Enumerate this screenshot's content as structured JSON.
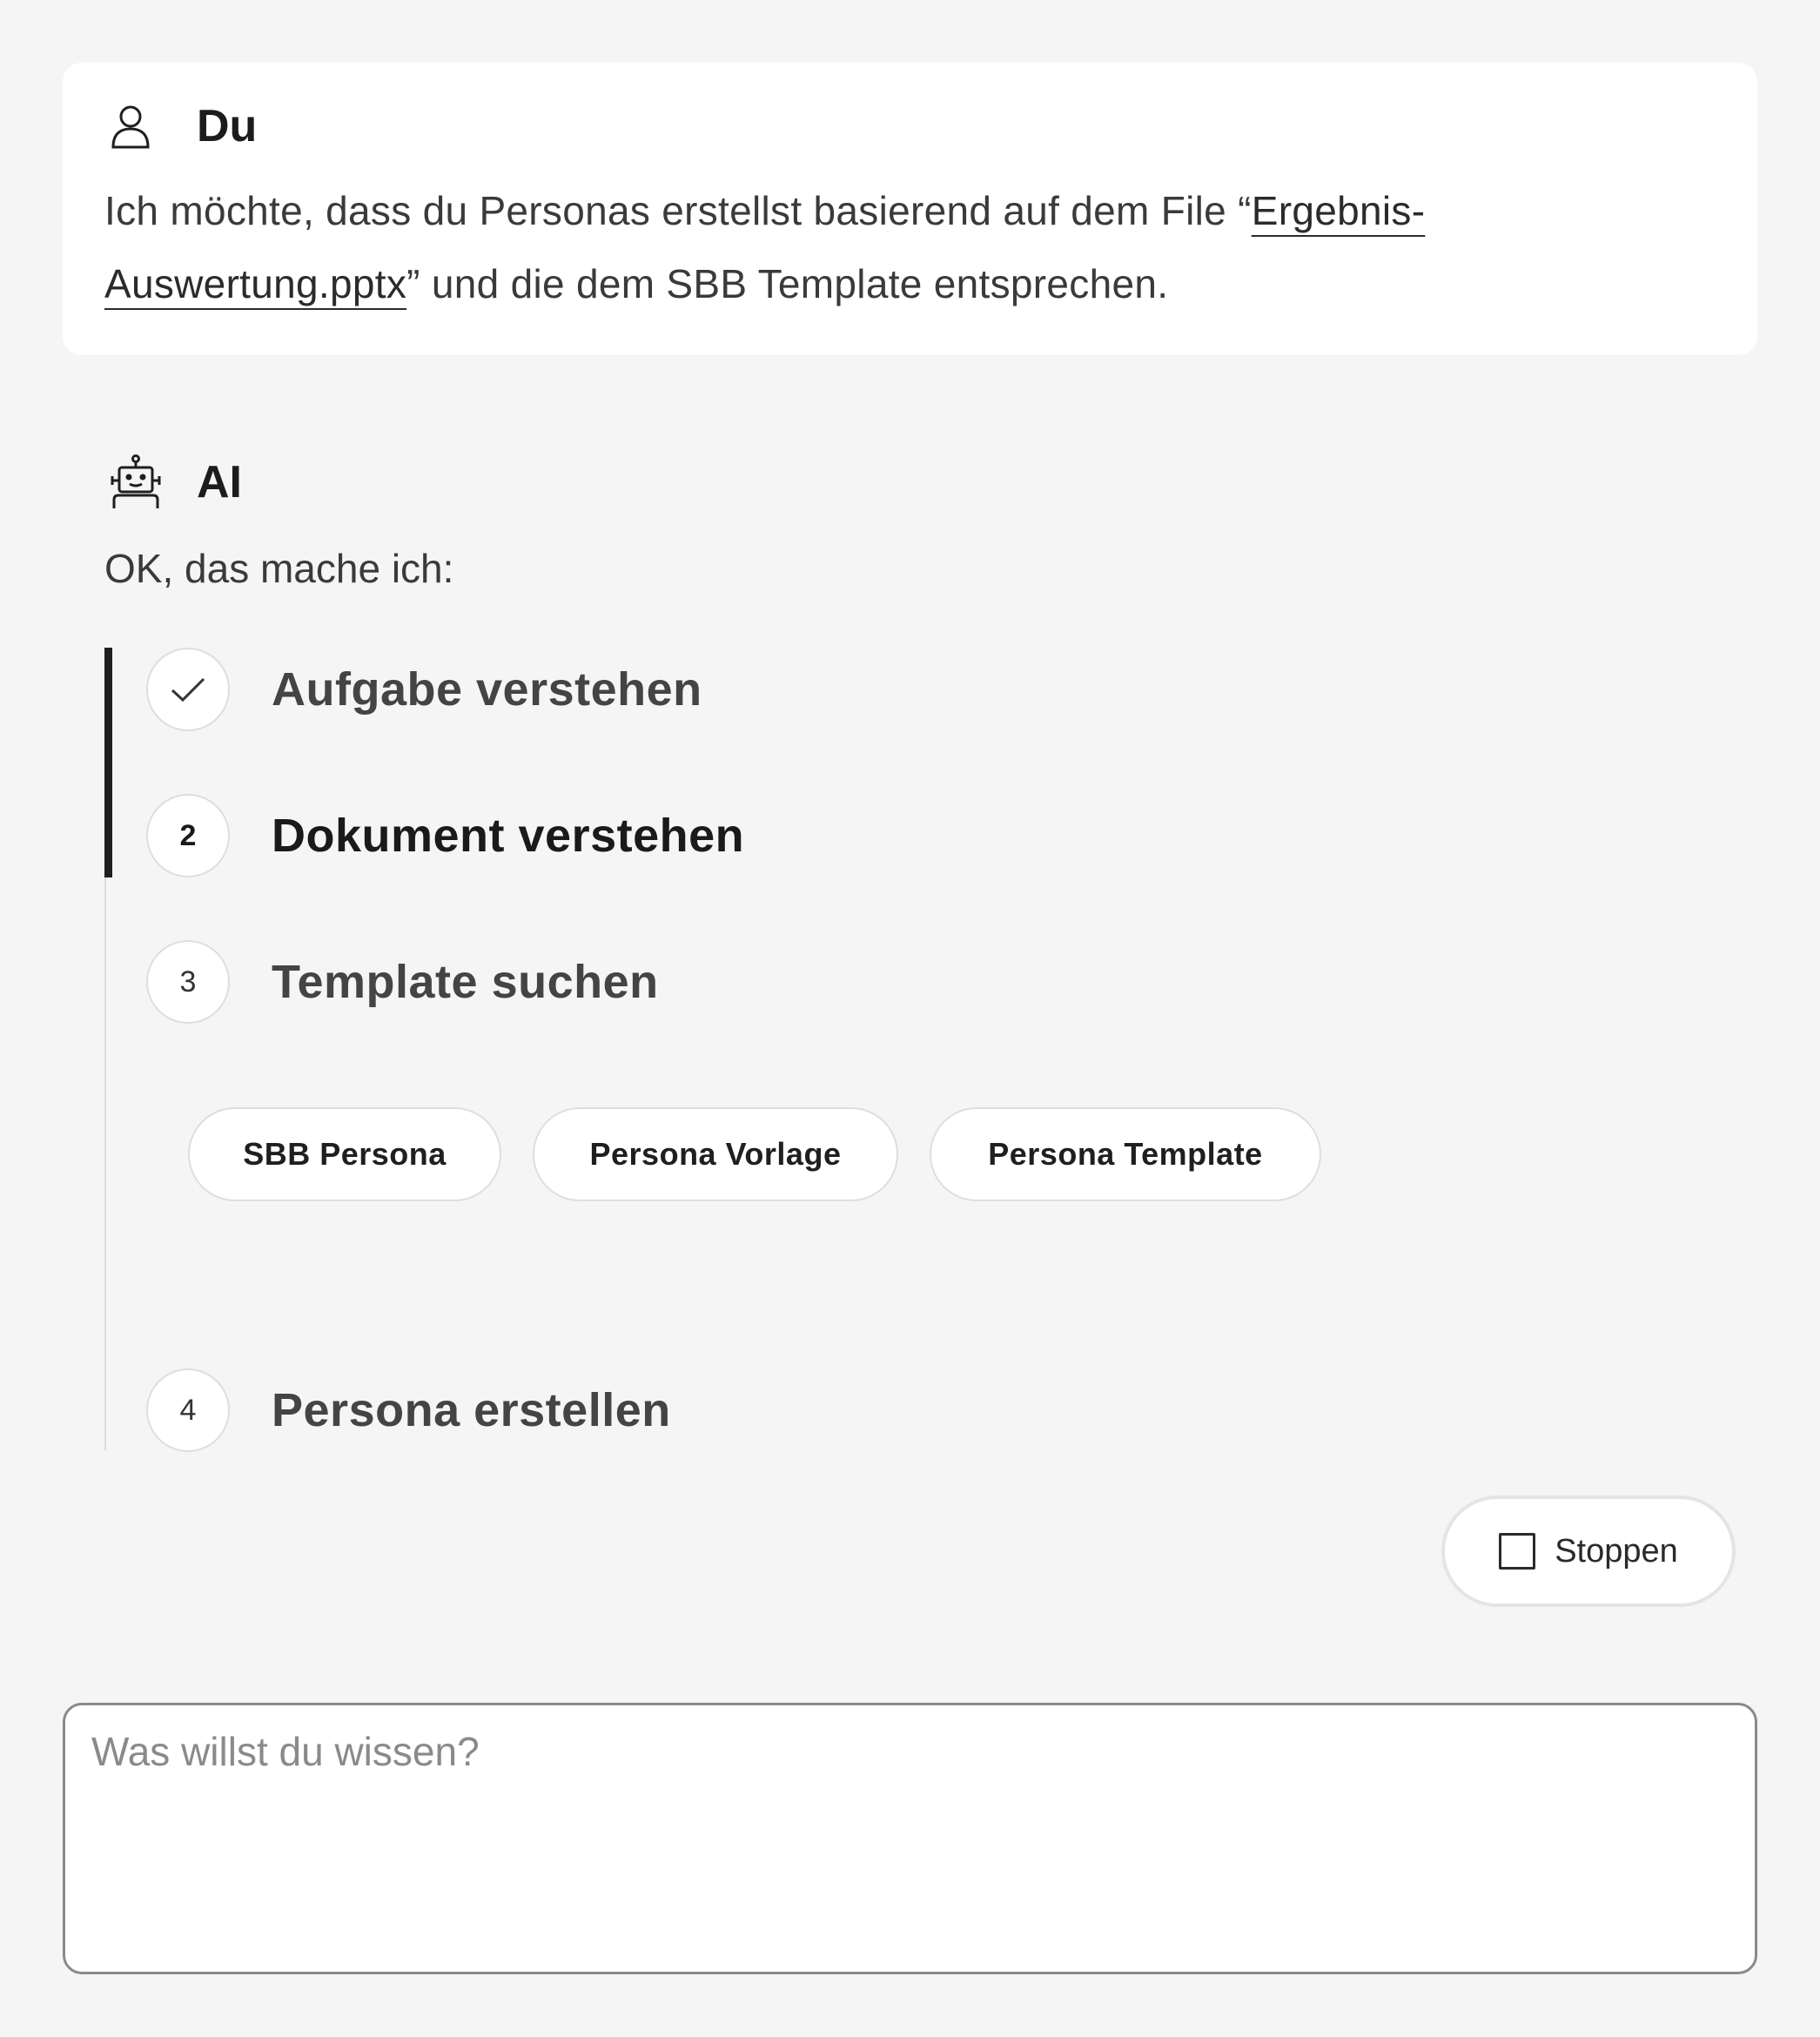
{
  "user_message": {
    "author": "Du",
    "icon": "user-icon",
    "text_before": "Ich möchte, dass du Personas erstellst basierend auf dem File “",
    "link_text": "Ergebnis-Auswertung.pptx",
    "text_after": "” und die dem SBB Template entsprechen."
  },
  "ai_message": {
    "author": "AI",
    "icon": "robot-icon",
    "intro": "OK, das mache ich:",
    "steps": [
      {
        "marker": "✓",
        "label": "Aufgabe verstehen",
        "state": "done"
      },
      {
        "marker": "2",
        "label": "Dokument verstehen",
        "state": "active"
      },
      {
        "marker": "3",
        "label": "Template suchen",
        "state": "pending"
      },
      {
        "marker": "4",
        "label": "Persona erstellen",
        "state": "pending"
      }
    ],
    "suggestions": [
      "SBB Persona",
      "Persona Vorlage",
      "Persona Template"
    ]
  },
  "stop_button": {
    "label": "Stoppen",
    "icon": "stop-square-icon"
  },
  "composer": {
    "placeholder": "Was willst du wissen?",
    "value": ""
  },
  "colors": {
    "background": "#f5f5f5",
    "card": "#ffffff",
    "text": "#212121",
    "active_track": "#1f1f1f"
  }
}
